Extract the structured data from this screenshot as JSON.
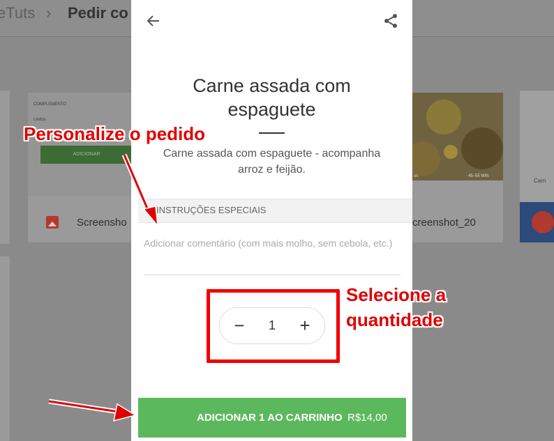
{
  "background": {
    "breadcrumb_root": "eTuts",
    "breadcrumb_current": "Pedir co",
    "card_left_small_header": "COMPLEMENTO",
    "card_left_small_item": "Lindos",
    "card_left_add_label": "ADICIONAR",
    "card_left_file": "Screensho",
    "card_right_file": "creenshot_20",
    "card_right_time": "45–55 MIN",
    "card_right_meta": "os",
    "side_card_text": "Carn"
  },
  "modal": {
    "title": "Carne assada com espaguete",
    "description": "Carne assada com espaguete - acompanha arroz e feijão.",
    "section_label": "INSTRUÇÕES ESPECIAIS",
    "comment_placeholder": "Adicionar comentário (com mais molho, sem cebola, etc.)",
    "quantity": "1",
    "minus_label": "−",
    "plus_label": "+",
    "add_button_label": "ADICIONAR 1 AO CARRINHO",
    "add_button_price": "R$14,00"
  },
  "annotations": {
    "personalize": "Personalize o pedido",
    "select_line1": "Selecione a",
    "select_line2": "quantidade"
  },
  "colors": {
    "accent_green": "#5cb85c",
    "annotation_red": "#e00000"
  },
  "icons": {
    "back": "arrow-left-icon",
    "share": "share-icon"
  }
}
